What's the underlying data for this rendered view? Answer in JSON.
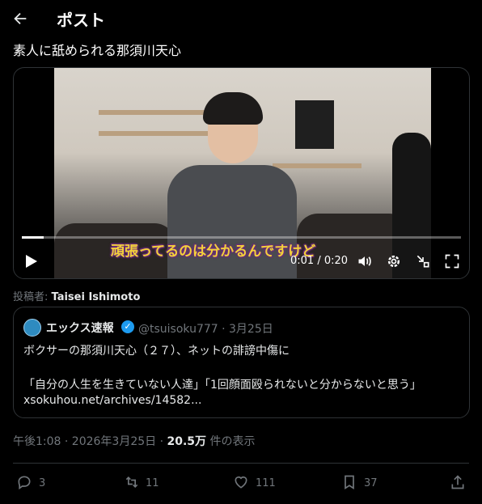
{
  "header": {
    "title": "ポスト"
  },
  "post": {
    "text": "素人に舐められる那須川天心"
  },
  "video": {
    "subtitle": "頑張ってるのは分かるんですけど",
    "time_current": "0:01",
    "time_total": "0:20",
    "progress": 0.05
  },
  "poster": {
    "label": "投稿者: ",
    "name": "Taisei Ishimoto"
  },
  "quote": {
    "name": "エックス速報",
    "handle": "@tsuisoku777 · 3月25日",
    "line1": "ボクサーの那須川天心（２７）、ネットの誹謗中傷に",
    "line2": "「自分の人生を生きていない人達」「1回顔面殴られないと分からないと思う」",
    "link": "xsokuhou.net/archives/14582..."
  },
  "meta": {
    "datetime": "午後1:08 · 2026年3月25日 · ",
    "views": "20.5万",
    "views_suffix": " 件の表示"
  },
  "actions": {
    "replies": "3",
    "reposts": "11",
    "likes": "111",
    "bookmarks": "37"
  },
  "colors": {
    "accent": "#1d9bf0",
    "muted": "#71767b",
    "subtitle": "#f3d23a"
  }
}
